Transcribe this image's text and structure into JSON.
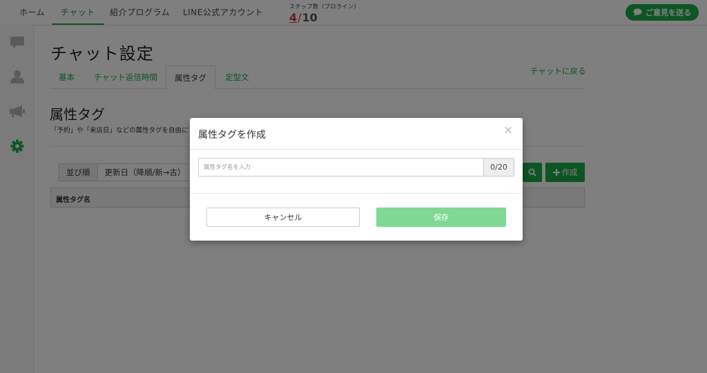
{
  "nav": {
    "items": [
      {
        "label": "ホーム",
        "active": false
      },
      {
        "label": "チャット",
        "active": true
      },
      {
        "label": "紹介プログラム",
        "active": false
      },
      {
        "label": "LINE公式アカウント",
        "active": false
      }
    ],
    "steps": {
      "label": "ステップ数（プロライン）",
      "current": "4",
      "separator": "/",
      "total": "10"
    },
    "feedback_label": "ご意見を送る"
  },
  "sidebar": {
    "items": [
      {
        "icon": "chat-bubble-icon",
        "active": false
      },
      {
        "icon": "user-icon",
        "active": false
      },
      {
        "icon": "megaphone-icon",
        "active": false
      },
      {
        "icon": "gear-icon",
        "active": true
      }
    ]
  },
  "main": {
    "title": "チャット設定",
    "tabs": [
      {
        "label": "基本",
        "active": false
      },
      {
        "label": "チャット返信時間",
        "active": false
      },
      {
        "label": "属性タグ",
        "active": true
      },
      {
        "label": "定型文",
        "active": false
      }
    ],
    "back_link": "チャットに戻る",
    "section_title": "属性タグ",
    "section_desc": "「予約」や「来店日」などの属性タグを自由に",
    "sort": {
      "label": "並び順",
      "value": "更新日（降順/新→古）"
    },
    "create_label": "作成",
    "table_header": "属性タグ名"
  },
  "modal": {
    "title": "属性タグを作成",
    "close": "×",
    "input": {
      "value": "",
      "placeholder": "属性タグ名を入力"
    },
    "counter": "0/20",
    "cancel_label": "キャンセル",
    "save_label": "保存"
  },
  "colors": {
    "accent": "#1aaa48",
    "save_disabled": "#7fd894",
    "step_current": "#dd3333"
  }
}
